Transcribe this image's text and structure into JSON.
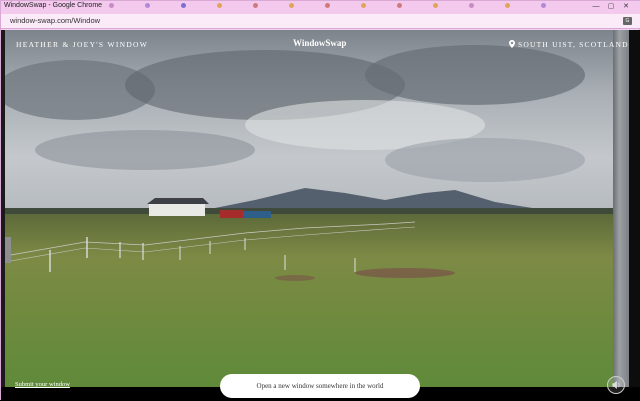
{
  "browser": {
    "tab_title": "WindowSwap - Google Chrome",
    "url": "window-swap.com/Window",
    "tabs": [
      {
        "label": "",
        "color": "#c98bc3"
      },
      {
        "label": "",
        "color": "#b08ad9"
      },
      {
        "label": "",
        "color": "#7a6fd6"
      },
      {
        "label": "",
        "color": "#e0a55a"
      },
      {
        "label": "",
        "color": "#d27a7a"
      },
      {
        "label": "",
        "color": "#e0a55a"
      },
      {
        "label": "",
        "color": "#d27a7a"
      },
      {
        "label": "",
        "color": "#e0a55a"
      },
      {
        "label": "",
        "color": "#d27a7a"
      },
      {
        "label": "",
        "color": "#e0a55a"
      },
      {
        "label": "",
        "color": "#c98bc3"
      },
      {
        "label": "",
        "color": "#e0a55a"
      },
      {
        "label": "",
        "color": "#b08ad9"
      }
    ],
    "controls": {
      "minimize": "—",
      "maximize": "▢",
      "close": "✕"
    },
    "translate_icon": "translate-icon"
  },
  "window_swap": {
    "window_owner": "Heather & Joey's window",
    "logo": "WindowSwap",
    "location": "South Uist, Scotland",
    "location_icon": "map-pin-icon",
    "submit_link": "Submit your window",
    "new_window_button": "Open a new window somewhere in the world",
    "sound_icon": "sound-icon"
  },
  "colors": {
    "chrome_pink": "#f3c9ee",
    "sky_top": "#8c9298",
    "grass": "#6f8a3e",
    "button_bg": "#ffffff"
  }
}
